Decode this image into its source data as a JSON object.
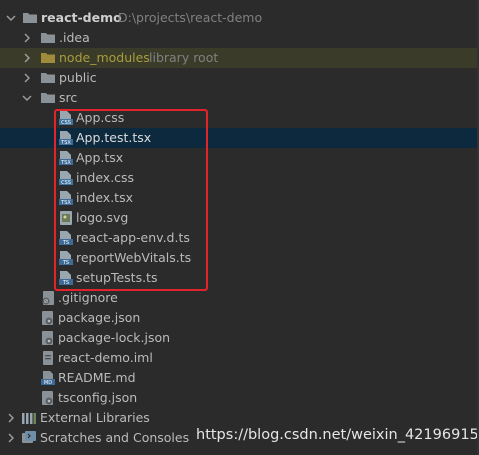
{
  "project": {
    "name": "react-demo",
    "path": "D:\\projects\\react-demo"
  },
  "folders": {
    "idea": ".idea",
    "node_modules": "node_modules",
    "node_modules_hint": "library root",
    "public": "public",
    "src": "src"
  },
  "src_files": [
    {
      "name": "App.css",
      "type": "css"
    },
    {
      "name": "App.test.tsx",
      "type": "tsx"
    },
    {
      "name": "App.tsx",
      "type": "tsx"
    },
    {
      "name": "index.css",
      "type": "css"
    },
    {
      "name": "index.tsx",
      "type": "tsx"
    },
    {
      "name": "logo.svg",
      "type": "svg"
    },
    {
      "name": "react-app-env.d.ts",
      "type": "ts"
    },
    {
      "name": "reportWebVitals.ts",
      "type": "ts"
    },
    {
      "name": "setupTests.ts",
      "type": "ts"
    }
  ],
  "root_files": [
    {
      "name": ".gitignore",
      "type": "gitignore"
    },
    {
      "name": "package.json",
      "type": "json"
    },
    {
      "name": "package-lock.json",
      "type": "json"
    },
    {
      "name": "react-demo.iml",
      "type": "iml"
    },
    {
      "name": "README.md",
      "type": "md"
    },
    {
      "name": "tsconfig.json",
      "type": "json"
    }
  ],
  "bottom": {
    "external_libraries": "External Libraries",
    "scratches": "Scratches and Consoles"
  },
  "watermark": "https://blog.csdn.net/weixin_42196915",
  "colors": {
    "background": "#2b2b2b",
    "selection": "#0d293e",
    "excluded_row": "#3b3b2a",
    "annotation_box": "#e0242a"
  },
  "icons": {
    "folder": "folder-icon",
    "css": "css-file-icon",
    "tsx": "tsx-file-icon",
    "ts": "ts-file-icon",
    "svg": "svg-file-icon",
    "json": "json-file-icon",
    "md": "markdown-file-icon"
  }
}
